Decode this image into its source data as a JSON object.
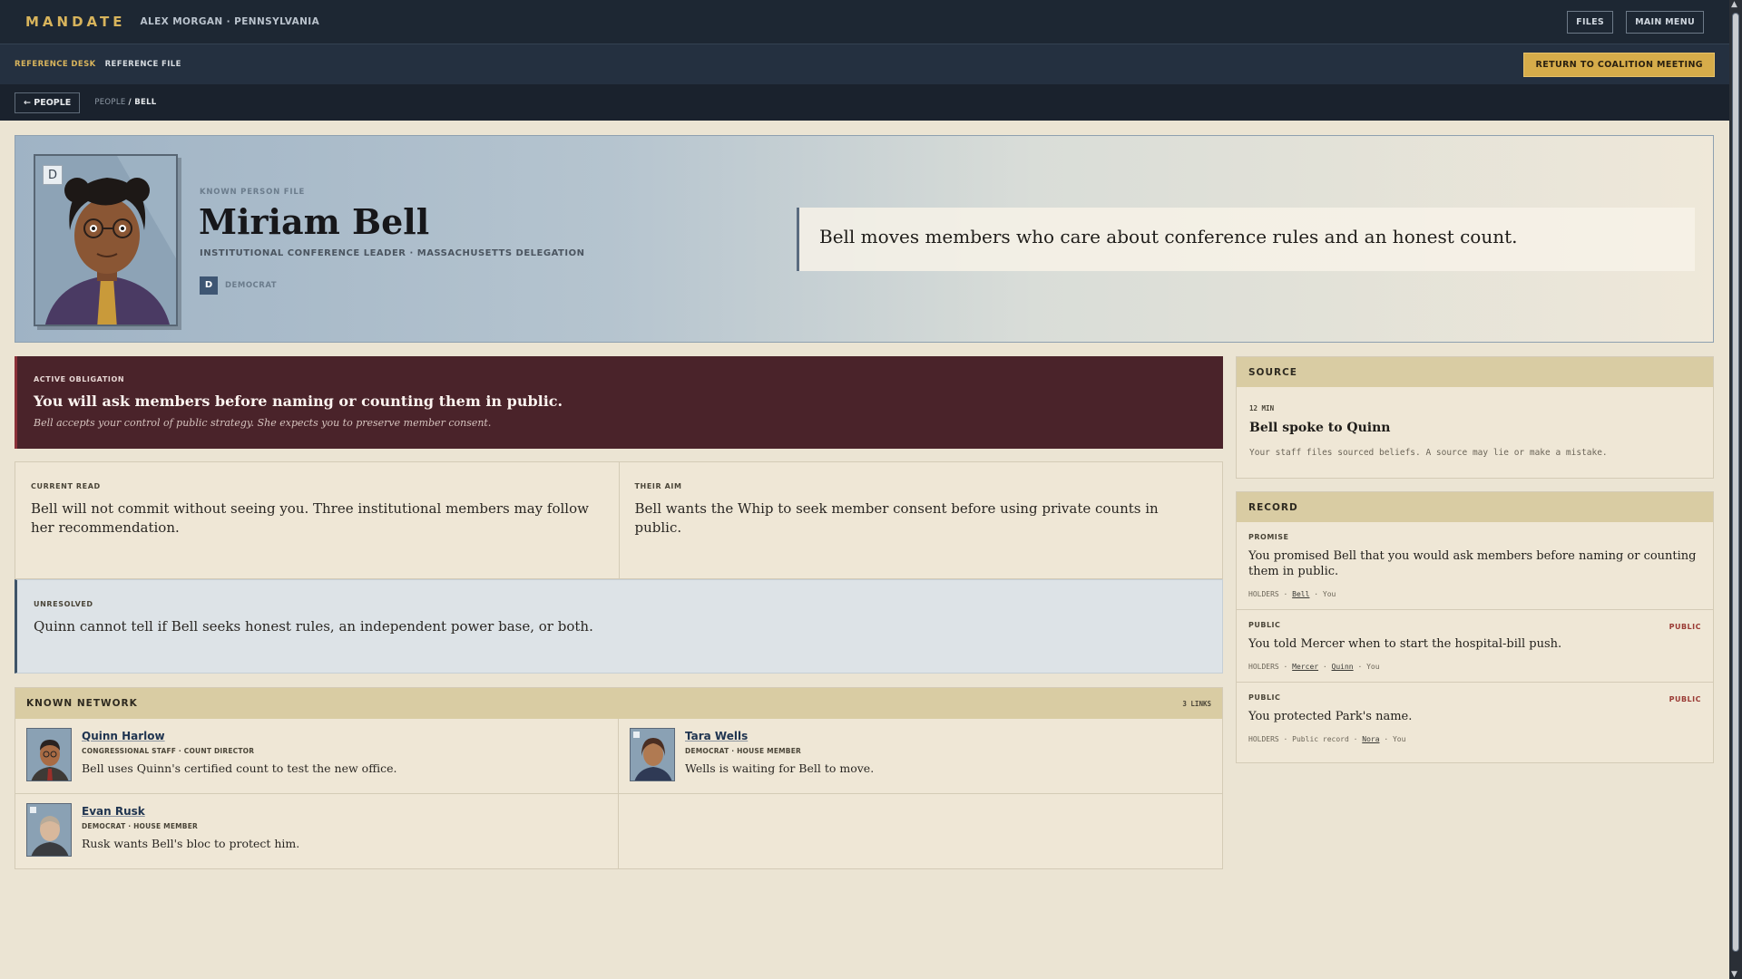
{
  "topbar": {
    "brand": "MANDATE",
    "player": "ALEX MORGAN · PENNSYLVANIA",
    "files_label": "FILES",
    "menu_label": "MAIN MENU"
  },
  "subbar": {
    "tab_desk": "REFERENCE DESK",
    "tab_file": "REFERENCE FILE",
    "return_label": "RETURN TO COALITION MEETING"
  },
  "crumbbar": {
    "back_label": "← PEOPLE",
    "crumb_root": "PEOPLE",
    "crumb_current": "/ BELL"
  },
  "hero": {
    "party_badge": "D",
    "kicker": "KNOWN PERSON FILE",
    "name": "Miriam Bell",
    "role": "INSTITUTIONAL CONFERENCE LEADER · MASSACHUSETTS DELEGATION",
    "party_letter": "D",
    "party_name": "DEMOCRAT",
    "quote": "Bell moves members who care about conference rules and an honest count."
  },
  "obligation": {
    "kicker": "ACTIVE OBLIGATION",
    "title": "You will ask members before naming or counting them in public.",
    "subtitle": "Bell accepts your control of public strategy. She expects you to preserve member consent."
  },
  "current_read": {
    "kicker": "CURRENT READ",
    "text": "Bell will not commit without seeing you. Three institutional members may follow her recommendation."
  },
  "their_aim": {
    "kicker": "THEIR AIM",
    "text": "Bell wants the Whip to seek member consent before using private counts in public."
  },
  "unresolved": {
    "kicker": "UNRESOLVED",
    "text": "Quinn cannot tell if Bell seeks honest rules, an independent power base, or both."
  },
  "network": {
    "heading": "KNOWN NETWORK",
    "count": "3 LINKS",
    "people": [
      {
        "name": "Quinn Harlow",
        "role": "CONGRESSIONAL STAFF · COUNT DIRECTOR",
        "note": "Bell uses Quinn's certified count to test the new office."
      },
      {
        "name": "Tara Wells",
        "role": "DEMOCRAT · HOUSE MEMBER",
        "note": "Wells is waiting for Bell to move."
      },
      {
        "name": "Evan Rusk",
        "role": "DEMOCRAT · HOUSE MEMBER",
        "note": "Rusk wants Bell's bloc to protect him."
      }
    ]
  },
  "source": {
    "heading": "SOURCE",
    "time": "12 MIN",
    "title": "Bell spoke to Quinn",
    "desc": "Your staff files sourced beliefs. A source may lie or make a mistake."
  },
  "record": {
    "heading": "RECORD",
    "items": [
      {
        "kicker": "PROMISE",
        "public": "",
        "text": "You promised Bell that you would ask members before naming or counting them in public.",
        "holders_label": "HOLDERS",
        "holders": "Bell",
        "holders_rest": "· You"
      },
      {
        "kicker": "PUBLIC",
        "public": "PUBLIC",
        "text": "You told Mercer when to start the hospital-bill push.",
        "holders_label": "HOLDERS",
        "holders": "Mercer",
        "holders_mid": "Quinn",
        "holders_rest": "· You"
      },
      {
        "kicker": "PUBLIC",
        "public": "PUBLIC",
        "text": "You protected Park's name.",
        "holders_label": "HOLDERS",
        "holders_pre": "Public record",
        "holders": "Nora",
        "holders_rest": "· You"
      }
    ]
  },
  "colors": {
    "topbar": "#1d2733",
    "accent_gold": "#d6ac4a",
    "obligation_bg": "#4a232a",
    "panel_header": "#d9cca3",
    "page_bg": "#ebe4d3"
  }
}
